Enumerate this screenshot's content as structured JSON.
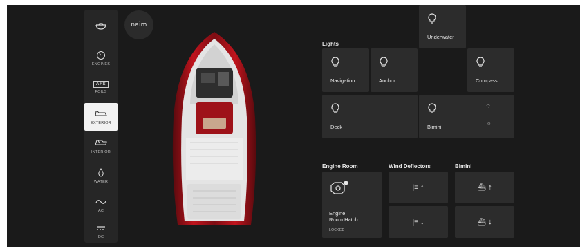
{
  "logo": {
    "text": "naim"
  },
  "sidebar": {
    "items": [
      {
        "icon": "boat-top-icon",
        "label": ""
      },
      {
        "icon": "gauge-icon",
        "label": "ENGINES"
      },
      {
        "icon": "afs-icon",
        "label": "FOILS",
        "badge": "AFS"
      },
      {
        "icon": "boat-exterior-icon",
        "label": "EXTERIOR",
        "active": true
      },
      {
        "icon": "boat-interior-icon",
        "label": "INTERIOR"
      },
      {
        "icon": "water-drop-icon",
        "label": "WATER"
      },
      {
        "icon": "wave-icon",
        "label": "AC"
      },
      {
        "icon": "dc-icon",
        "label": "DC"
      }
    ]
  },
  "lights": {
    "title": "Lights",
    "items": [
      "Navigation",
      "Anchor",
      "Underwater",
      "Compass",
      "Deck",
      "Bimini"
    ]
  },
  "engine_room": {
    "title": "Engine Room",
    "hatch_label_line1": "Engine",
    "hatch_label_line2": "Room Hatch",
    "status": "LOCKED"
  },
  "wind_deflectors": {
    "title": "Wind Deflectors",
    "up": "↑",
    "down": "↓"
  },
  "bimini": {
    "title": "Bimini",
    "up": "↑",
    "down": "↓"
  },
  "colors": {
    "background": "#1a1a1a",
    "tile": "#2c2c2c",
    "active": "#f2f2f2",
    "hull": "#b0121b"
  }
}
